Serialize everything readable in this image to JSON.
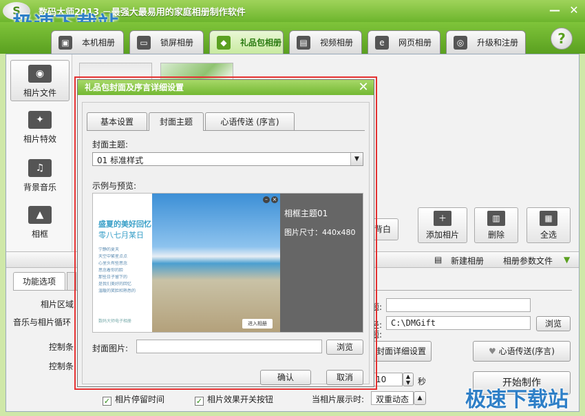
{
  "app": {
    "logo_text": "S",
    "title": "数码大师2013  －最强大最易用的家庭相册制作软件",
    "watermark": "极速下载站"
  },
  "top_tabs": [
    {
      "label": "本机相册",
      "icon": "photo-icon"
    },
    {
      "label": "锁屏相册",
      "icon": "monitor-icon"
    },
    {
      "label": "礼品包相册",
      "icon": "gift-icon",
      "active": true
    },
    {
      "label": "视频相册",
      "icon": "film-icon"
    },
    {
      "label": "网页相册",
      "icon": "ie-icon"
    },
    {
      "label": "升级和注册",
      "icon": "globe-icon"
    }
  ],
  "help_label": "?",
  "sidebar": [
    {
      "label": "相片文件",
      "icon": "camera-icon",
      "active": true
    },
    {
      "label": "相片特效",
      "icon": "effects-icon"
    },
    {
      "label": "背景音乐",
      "icon": "music-icon"
    },
    {
      "label": "相框",
      "icon": "frame-icon"
    }
  ],
  "actions": {
    "partial": "背白",
    "add_photo": "添加相片",
    "delete": "删除",
    "select_all": "全选"
  },
  "toolbar2": {
    "new_album": "新建相册",
    "album_params": "相册参数文件"
  },
  "bottom": {
    "func_tab": "功能选项",
    "photo_area": "相片区域",
    "music_loop": "音乐与相片循环",
    "control1": "控制条",
    "control2": "控制条",
    "stay_time": "相片停留时间",
    "effect_switch": "相片效果开关按钮",
    "display_mode_label": "当相片展示时:",
    "display_mode_value": "双重动态",
    "right_group_suffix": "题:",
    "field1_label_suffix": "题:",
    "output_label_suffix": "径:",
    "output_path": "C:\\DMGift",
    "browse": "浏览",
    "cover_detail_btn": "封面详细设置",
    "message_btn": "心语传送(序言)",
    "seconds_value": "10",
    "seconds_unit": "秒",
    "make_btn": "开始制作"
  },
  "dialog": {
    "title": "礼品包封面及序言详细设置",
    "tabs": [
      "基本设置",
      "封面主题",
      "心语传送 (序言)"
    ],
    "active_tab": 1,
    "theme_label": "封面主题:",
    "theme_value": "01 标准样式",
    "preview_label": "示例与预览:",
    "preview": {
      "heading": "盛夏的美好回忆",
      "sub": "零八七月某日",
      "lines": [
        "宁静的夏天",
        "天空中繁星点点",
        "心里头有些思念",
        "思念着你的脸",
        "那些日子留下的",
        "是我们美好的回忆",
        "温暖的笑脸和熟悉的"
      ],
      "foot": "数码大师电子相册",
      "enter": "进入相册",
      "info_title": "相框主题01",
      "info_size": "图片尺寸：440x480"
    },
    "cover_image_label": "封面图片:",
    "cover_image_value": "",
    "browse": "浏览",
    "ok": "确认",
    "cancel": "取消"
  }
}
